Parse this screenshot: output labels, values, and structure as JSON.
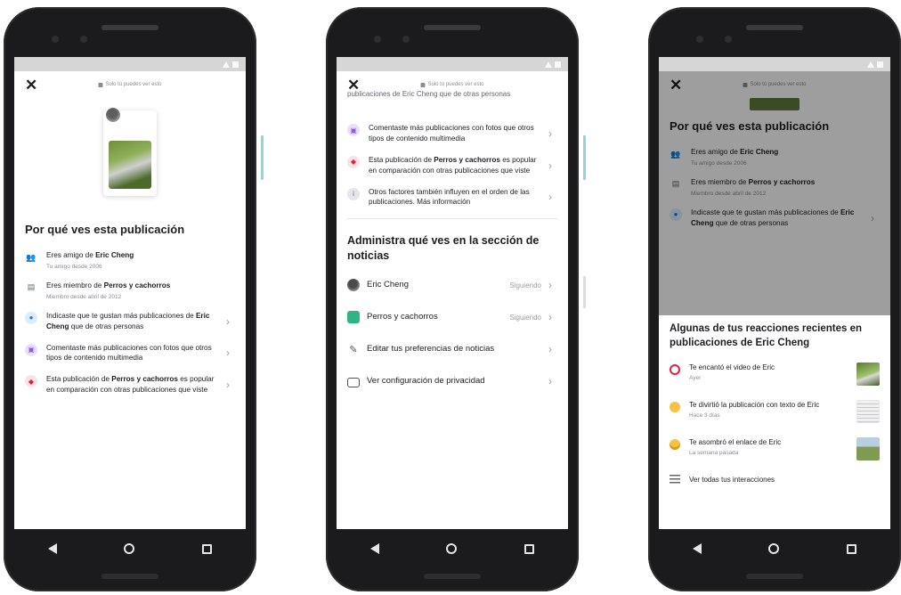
{
  "screen1": {
    "privacy_label": "Solo tú puedes ver esto",
    "heading": "Por qué ves esta publicación",
    "reasons": [
      {
        "text_a": "Eres amigo de ",
        "bold": "Eric Cheng",
        "text_b": "",
        "sub": "Tu amigo desde 2006"
      },
      {
        "text_a": "Eres miembro de ",
        "bold": "Perros y cachorros",
        "text_b": "",
        "sub": "Miembro desde abril de 2012"
      },
      {
        "text_a": "Indicaste que te gustan más publicaciones de ",
        "bold": "Eric Cheng",
        "text_b": " que de otras personas",
        "sub": ""
      },
      {
        "text_a": "Comentaste más publicaciones con fotos que otros tipos de contenido multimedia",
        "bold": "",
        "text_b": "",
        "sub": ""
      },
      {
        "text_a": "Esta publicación de ",
        "bold": "Perros y cachorros",
        "text_b": " es popular en comparación con otras publicaciones que viste",
        "sub": ""
      }
    ]
  },
  "screen2": {
    "privacy_label": "Solo tú puedes ver esto",
    "partial_top": "publicaciones de Eric Cheng que de otras personas",
    "reasons": [
      {
        "text_a": "Comentaste más publicaciones con fotos que otros tipos de contenido multimedia",
        "bold": "",
        "text_b": ""
      },
      {
        "text_a": "Esta publicación de ",
        "bold": "Perros y cachorros",
        "text_b": " es popular en comparación con otras publicaciones que viste"
      },
      {
        "text_a": "Otros factores también influyen en el orden de las publicaciones. Más información",
        "bold": "",
        "text_b": ""
      }
    ],
    "manage_heading": "Administra qué ves en la sección de noticias",
    "manage_items": [
      {
        "label": "Eric Cheng",
        "status": "Siguiendo"
      },
      {
        "label": "Perros y cachorros",
        "status": "Siguiendo"
      },
      {
        "label": "Editar tus preferencias de noticias",
        "status": ""
      },
      {
        "label": "Ver configuración de privacidad",
        "status": ""
      }
    ]
  },
  "screen3": {
    "privacy_label": "Solo tú puedes ver esto",
    "heading": "Por qué ves esta publicación",
    "reasons": [
      {
        "text_a": "Eres amigo de ",
        "bold": "Eric Cheng",
        "text_b": "",
        "sub": "Tu amigo desde 2006"
      },
      {
        "text_a": "Eres miembro de ",
        "bold": "Perros y cachorros",
        "text_b": "",
        "sub": "Miembro desde abril de 2012"
      },
      {
        "text_a": "Indicaste que te gustan más publicaciones de ",
        "bold": "Eric Cheng",
        "text_b": " que de otras personas",
        "sub": ""
      }
    ],
    "sheet_heading": "Algunas de tus reacciones recientes en publicaciones de Eric Cheng",
    "reactions": [
      {
        "text": "Te encantó el video de Eric",
        "sub": "Ayer"
      },
      {
        "text": "Te divirtió la publicación con texto de Eric",
        "sub": "Hace 3 días"
      },
      {
        "text": "Te asombró el enlace de Eric",
        "sub": "La semana pasada"
      }
    ],
    "all_label": "Ver todas tus interacciones"
  },
  "colors": {
    "accent_blue": "#1877f2",
    "love_red": "#e41e3f",
    "haha_yellow": "#f7c242",
    "group_green": "#2fb583"
  }
}
